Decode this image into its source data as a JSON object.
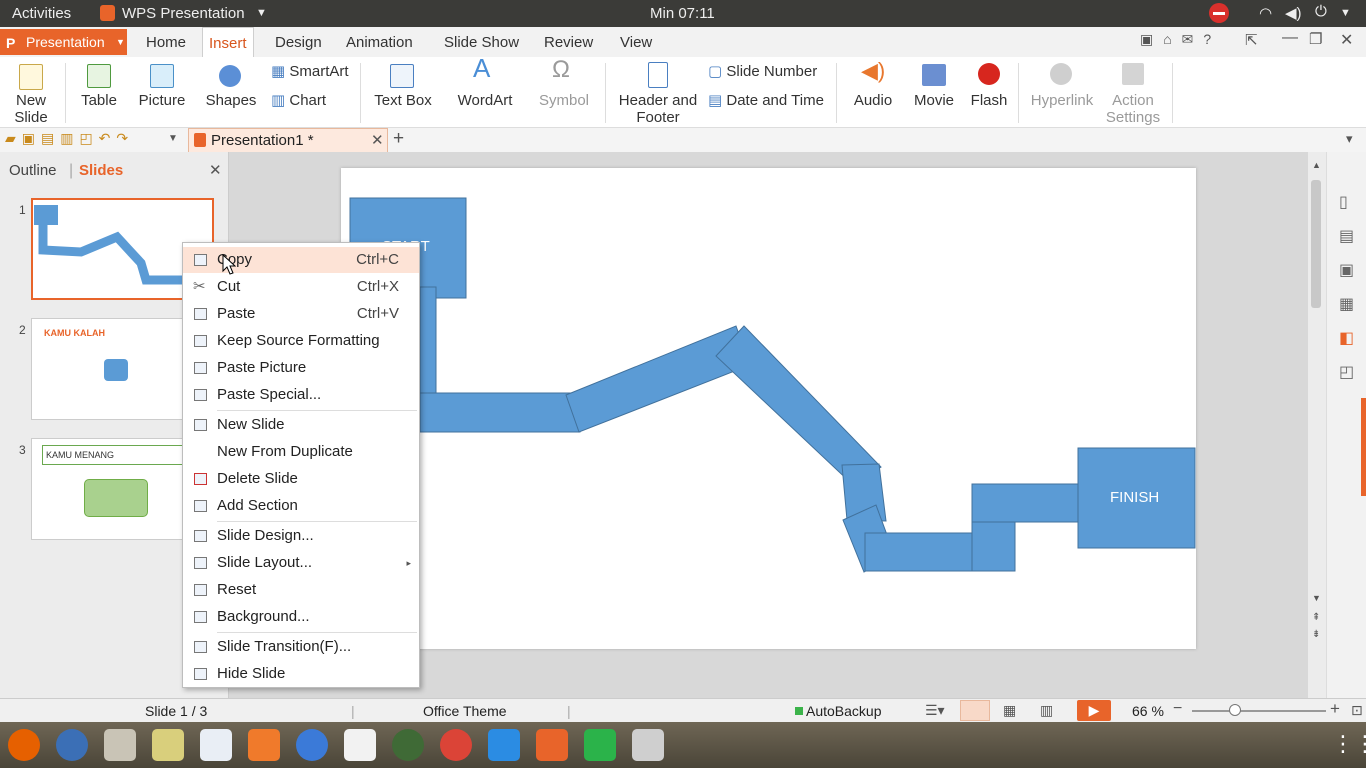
{
  "topbar": {
    "activities": "Activities",
    "app_name": "WPS Presentation",
    "clock": "Min 07:11"
  },
  "ribbon_tabs": [
    "Home",
    "Insert",
    "Design",
    "Animation",
    "Slide Show",
    "Review",
    "View"
  ],
  "active_tab": "Insert",
  "app_menu_label": "Presentation",
  "ribbon": {
    "new_slide": "New Slide",
    "table": "Table",
    "picture": "Picture",
    "shapes": "Shapes",
    "smartart": "SmartArt",
    "chart": "Chart",
    "text_box": "Text Box",
    "wordart": "WordArt",
    "symbol": "Symbol",
    "header_footer": "Header and Footer",
    "slide_number": "Slide Number",
    "date_time": "Date and Time",
    "audio": "Audio",
    "movie": "Movie",
    "flash": "Flash",
    "hyperlink": "Hyperlink",
    "action_settings": "Action Settings"
  },
  "document_tab": "Presentation1 *",
  "panel_tabs": {
    "outline": "Outline",
    "slides": "Slides"
  },
  "slides": [
    {
      "number": "1"
    },
    {
      "number": "2",
      "title": "KAMU KALAH"
    },
    {
      "number": "3",
      "title": "KAMU MENANG"
    }
  ],
  "slide_canvas": {
    "start_label": "START",
    "finish_label": "FINISH"
  },
  "context_menu": [
    {
      "label": "Copy",
      "shortcut": "Ctrl+C",
      "highlighted": true
    },
    {
      "label": "Cut",
      "shortcut": "Ctrl+X"
    },
    {
      "label": "Paste",
      "shortcut": "Ctrl+V"
    },
    {
      "label": "Keep Source Formatting"
    },
    {
      "label": "Paste Picture"
    },
    {
      "label": "Paste Special..."
    },
    {
      "label": "New Slide"
    },
    {
      "label": "New From Duplicate"
    },
    {
      "label": "Delete Slide"
    },
    {
      "label": "Add Section"
    },
    {
      "label": "Slide Design..."
    },
    {
      "label": "Slide Layout...",
      "submenu": true
    },
    {
      "label": "Reset"
    },
    {
      "label": "Background..."
    },
    {
      "label": "Slide Transition(F)..."
    },
    {
      "label": "Hide Slide"
    }
  ],
  "status": {
    "slide_counter": "Slide 1 / 3",
    "theme": "Office Theme",
    "autobackup": "AutoBackup",
    "zoom": "66 %"
  },
  "colors": {
    "accent": "#e8642a",
    "shape_fill": "#5b9bd5",
    "shape_border": "#41719c"
  }
}
